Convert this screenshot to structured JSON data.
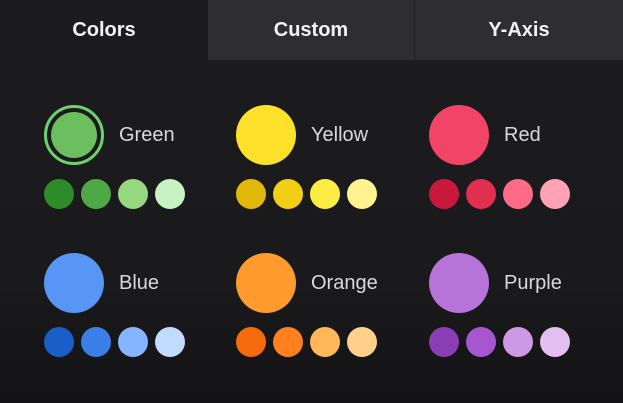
{
  "tabs": [
    {
      "label": "Colors",
      "active": true
    },
    {
      "label": "Custom",
      "active": false
    },
    {
      "label": "Y-Axis",
      "active": false
    }
  ],
  "colors": [
    {
      "name": "Green",
      "main": "#6cbf5f",
      "selected": true,
      "shades": [
        "#2e8b2a",
        "#4ea845",
        "#95d880",
        "#c9f2c2"
      ]
    },
    {
      "name": "Yellow",
      "main": "#fde02a",
      "selected": false,
      "shades": [
        "#e2b808",
        "#f3cf14",
        "#fded43",
        "#fff28f"
      ]
    },
    {
      "name": "Red",
      "main": "#f24467",
      "selected": false,
      "shades": [
        "#c8193c",
        "#e22e4f",
        "#ff6a88",
        "#ffa2b5"
      ]
    },
    {
      "name": "Blue",
      "main": "#5796f5",
      "selected": false,
      "shades": [
        "#1a5fc7",
        "#3b7fe6",
        "#86b4ff",
        "#c3daff"
      ]
    },
    {
      "name": "Orange",
      "main": "#ff9a2e",
      "selected": false,
      "shades": [
        "#f46a0c",
        "#ff801c",
        "#ffb757",
        "#ffd08c"
      ]
    },
    {
      "name": "Purple",
      "main": "#b674d8",
      "selected": false,
      "shades": [
        "#8a3eb3",
        "#a656ce",
        "#cd98e4",
        "#e3bff1"
      ]
    }
  ]
}
